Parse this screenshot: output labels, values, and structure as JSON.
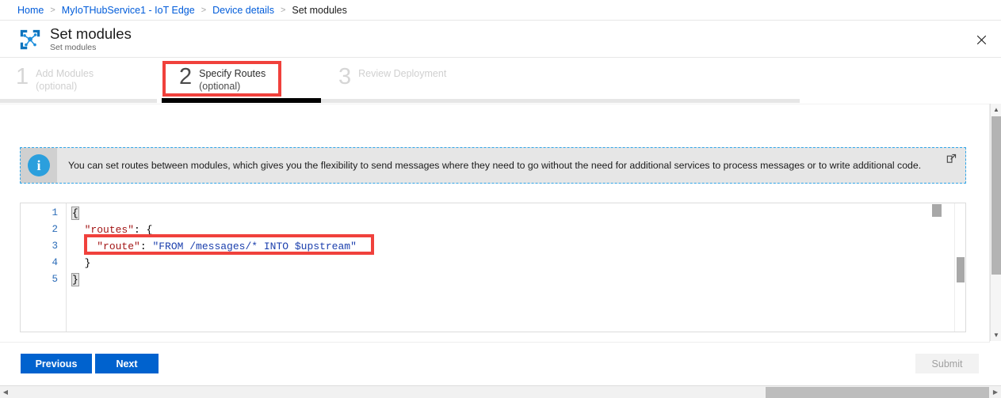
{
  "breadcrumb": {
    "items": [
      {
        "label": "Home",
        "type": "link"
      },
      {
        "label": "MyIoTHubService1 - IoT Edge",
        "type": "link"
      },
      {
        "label": "Device details",
        "type": "link"
      },
      {
        "label": "Set modules",
        "type": "current"
      }
    ],
    "separator": ">"
  },
  "blade": {
    "icon": "iot-edge-icon",
    "title": "Set modules",
    "subtitle": "Set modules",
    "close_label": "✕"
  },
  "steps": [
    {
      "number": "1",
      "label": "Add Modules",
      "sub": "(optional)",
      "state": "inactive"
    },
    {
      "number": "2",
      "label": "Specify Routes",
      "sub": "(optional)",
      "state": "active"
    },
    {
      "number": "3",
      "label": "Review Deployment",
      "sub": "",
      "state": "inactive"
    }
  ],
  "info_banner": {
    "icon": "info-icon",
    "icon_glyph": "i",
    "text": "You can set routes between modules, which gives you the flexibility to send messages where they need to go without the need for additional services to process messages or to write additional code.",
    "external_link_icon": "external-link-icon"
  },
  "editor": {
    "lines": [
      {
        "number": "1",
        "segments": [
          {
            "t": "{",
            "k": "punc-match"
          }
        ]
      },
      {
        "number": "2",
        "segments": [
          {
            "t": "  ",
            "k": "punc"
          },
          {
            "t": "\"routes\"",
            "k": "key"
          },
          {
            "t": ": {",
            "k": "punc"
          }
        ]
      },
      {
        "number": "3",
        "segments": [
          {
            "t": "    ",
            "k": "punc"
          },
          {
            "t": "\"route\"",
            "k": "key"
          },
          {
            "t": ": ",
            "k": "punc"
          },
          {
            "t": "\"FROM /messages/* INTO $upstream\"",
            "k": "str"
          }
        ]
      },
      {
        "number": "4",
        "segments": [
          {
            "t": "  }",
            "k": "punc"
          }
        ]
      },
      {
        "number": "5",
        "segments": [
          {
            "t": "}",
            "k": "punc-match"
          }
        ]
      }
    ]
  },
  "annotations": [
    {
      "name": "redbox-step2",
      "color": "#f0413c",
      "target": "Specify Routes step"
    },
    {
      "name": "redbox-route",
      "color": "#f0413c",
      "target": "route line 3"
    }
  ],
  "footer": {
    "previous_label": "Previous",
    "next_label": "Next",
    "submit_label": "Submit",
    "submit_disabled": true
  },
  "colors": {
    "accent_blue": "#0062ce",
    "link_blue": "#015cda",
    "annotation_red": "#f0413c",
    "active_step_bar": "#000000",
    "inactive_step_bar": "#e6e6e6",
    "info_icon_blue": "#2b9fdd",
    "json_key": "#a31515",
    "json_string": "#1b3fad"
  },
  "scrollbars": {
    "page_vertical_up": "▲",
    "page_vertical_down": "▼",
    "page_horizontal_left": "◀",
    "page_horizontal_right": "▶"
  }
}
